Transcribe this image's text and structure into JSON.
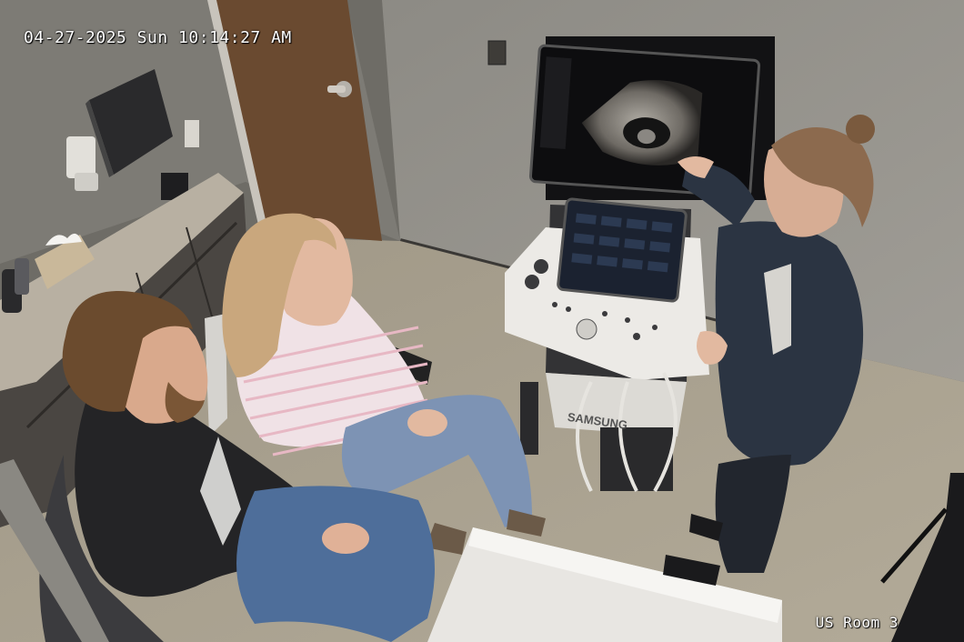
{
  "overlay": {
    "timestamp": "04-27-2025 Sun 10:14:27 AM",
    "camera_label": "US Room 3"
  },
  "ultrasound": {
    "brand_label": "SAMSUNG"
  },
  "colors": {
    "wall": "#8f8d87",
    "floor": "#a79f8d",
    "door": "#6a4a30",
    "counter": "#b8b0a2",
    "cabinet": "#4a4642",
    "scrubs": "#2b3442",
    "sweater_stripe": "#e7b8c4"
  }
}
